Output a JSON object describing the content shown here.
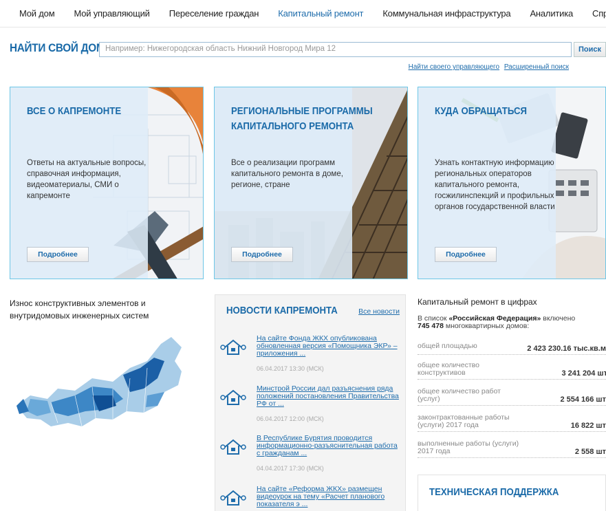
{
  "nav": {
    "items": [
      {
        "label": "Мой дом",
        "active": false
      },
      {
        "label": "Мой управляющий",
        "active": false
      },
      {
        "label": "Переселение граждан",
        "active": false
      },
      {
        "label": "Капитальный ремонт",
        "active": true
      },
      {
        "label": "Коммунальная инфраструктура",
        "active": false
      },
      {
        "label": "Аналитика",
        "active": false
      },
      {
        "label": "Справка",
        "active": false
      }
    ]
  },
  "search": {
    "title": "НАЙТИ СВОЙ ДОМ",
    "placeholder": "Например: Нижегородская область Нижний Новгород Мира 12",
    "button": "Поиск",
    "link_manager": "Найти своего управляющего",
    "link_advanced": "Расширенный поиск"
  },
  "cards": [
    {
      "title": "ВСЕ О КАПРЕМОНТЕ",
      "text": "Ответы на актуальные вопросы, справочная информация, видеоматериалы, СМИ о капремонте",
      "button": "Подробнее"
    },
    {
      "title": "РЕГИОНАЛЬНЫЕ ПРОГРАММЫ КАПИТАЛЬНОГО РЕМОНТА",
      "text": "Все о реализации программ капитального ремонта в доме, регионе, стране",
      "button": "Подробнее"
    },
    {
      "title": "КУДА ОБРАЩАТЬСЯ",
      "text": "Узнать контактную информацию региональных операторов капитального ремонта, госжилинспекций и профильных органов государственной власти",
      "button": "Подробнее"
    }
  ],
  "wear": {
    "title": "Износ конструктивных элементов и внутридомовых инженерных систем"
  },
  "news": {
    "title": "НОВОСТИ КАПРЕМОНТА",
    "all_link": "Все новости",
    "items": [
      {
        "text": "На сайте Фонда ЖКХ опубликована обновленная версия «Помощника ЭКР» – приложения ...",
        "date": "06.04.2017 13:30 (МСК)"
      },
      {
        "text": "Минстрой России дал разъяснения ряда положений постановления Правительства РФ от ...",
        "date": "06.04.2017 12:00 (МСК)"
      },
      {
        "text": "В Республике Бурятия проводится информационно-разъяснительная работа с гражданам ...",
        "date": "04.04.2017 17:30 (МСК)"
      },
      {
        "text": "На сайте «Реформа ЖКХ» размещен видеоурок на тему «Расчет планового показателя э ...",
        "date": ""
      }
    ]
  },
  "figures": {
    "title": "Капитальный ремонт в цифрах",
    "intro_prefix": "В список ",
    "intro_region": "«Российская Федерация»",
    "intro_mid": " включено",
    "intro_count": "745 478",
    "intro_suffix": " многоквартирных домов:",
    "rows": [
      {
        "label": "общей площадью",
        "value": "2 423 230.16 тыс.кв.м"
      },
      {
        "label": "общее количество конструктивов",
        "value": "3 241 204 шт"
      },
      {
        "label": "общее количество работ (услуг)",
        "value": "2 554 166 шт"
      },
      {
        "label": "законтрактованные работы (услуги) 2017 года",
        "value": "16 822 шт"
      },
      {
        "label": "выполненные работы (услуги) 2017 года",
        "value": "2 558 шт"
      }
    ]
  },
  "support": {
    "title": "ТЕХНИЧЕСКАЯ ПОДДЕРЖКА"
  },
  "colors": {
    "accent": "#1a6aa8",
    "link": "#1e6cab",
    "card_border": "#6cc6e6"
  }
}
